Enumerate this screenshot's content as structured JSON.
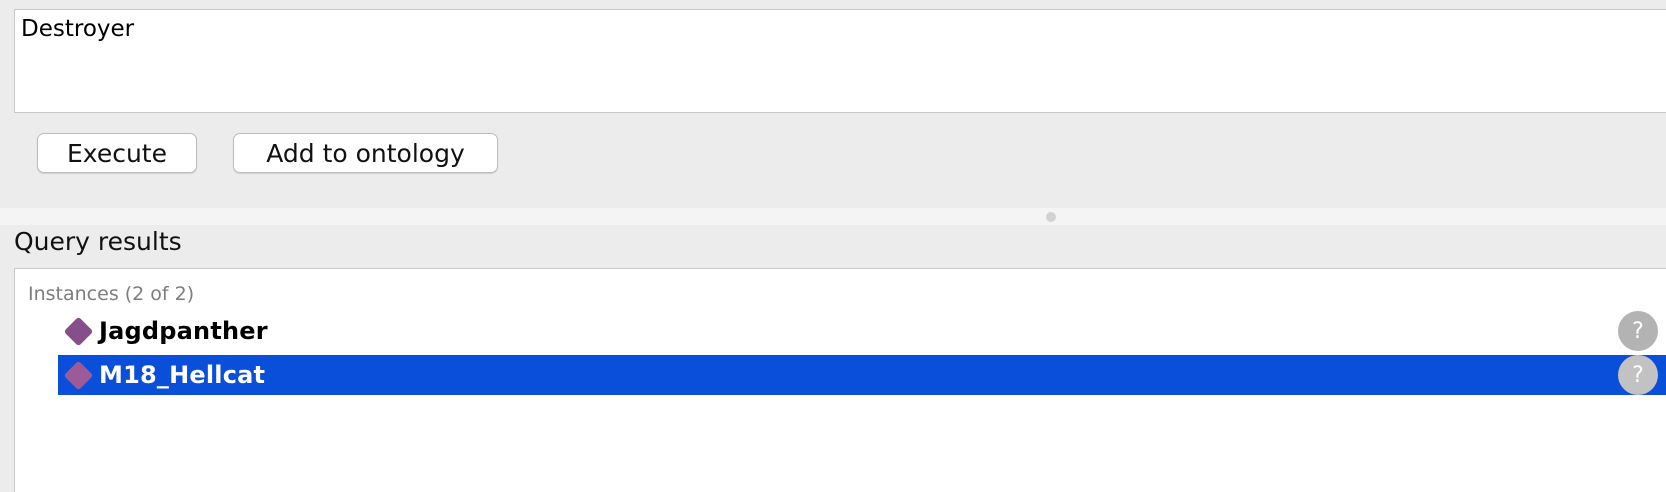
{
  "query": {
    "text": "Destroyer"
  },
  "buttons": {
    "execute_label": "Execute",
    "add_to_ontology_label": "Add to ontology"
  },
  "results": {
    "title": "Query results",
    "section_header": "Instances (2 of 2)",
    "items": [
      {
        "label": "Jagdpanther",
        "selected": false,
        "help": "?"
      },
      {
        "label": "M18_Hellcat",
        "selected": true,
        "help": "?"
      }
    ]
  },
  "colors": {
    "selection": "#0a4fda",
    "individual_icon": "#864f8c",
    "background": "#ececec"
  },
  "icons": {
    "individual": "diamond-individual-icon",
    "help": "help-circle-icon"
  }
}
